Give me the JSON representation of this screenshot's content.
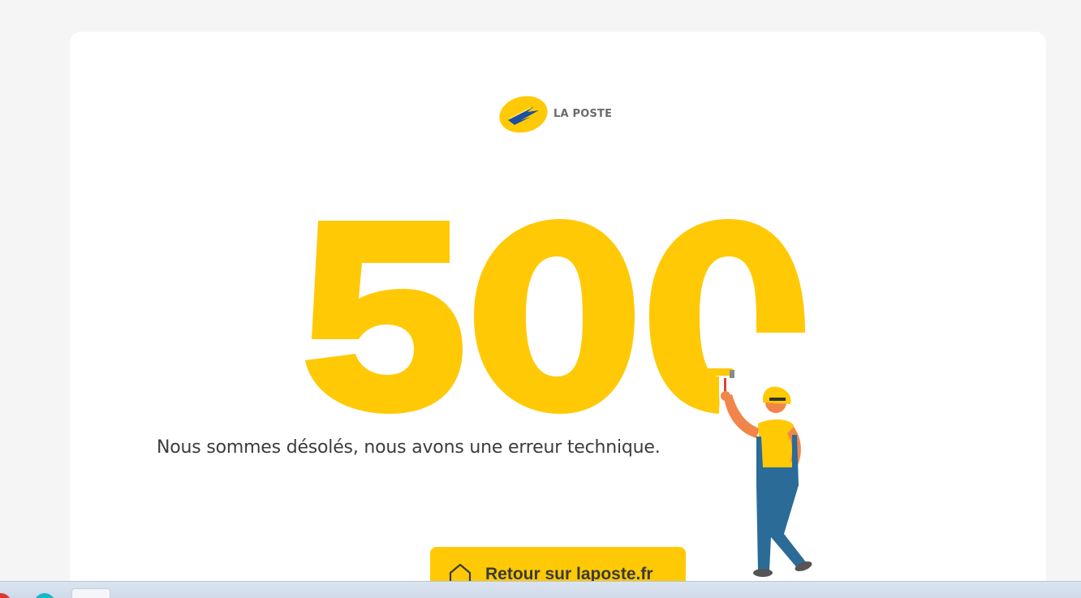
{
  "logo": {
    "text": "LA POSTE",
    "icon": "la-poste-bird-logo-icon"
  },
  "error": {
    "code": "500"
  },
  "message": "Nous sommes désolés, nous avons une erreur technique.",
  "button": {
    "label": "Retour sur laposte.fr",
    "icon": "home-icon"
  },
  "colors": {
    "brand_yellow": "#ffc905",
    "brand_blue": "#1d4fa3",
    "text": "#3c3c3c",
    "background": "#f5f5f5"
  },
  "taskbar": {
    "icons": [
      "browser-red-icon",
      "browser-teal-icon",
      "app-window-icon"
    ]
  }
}
